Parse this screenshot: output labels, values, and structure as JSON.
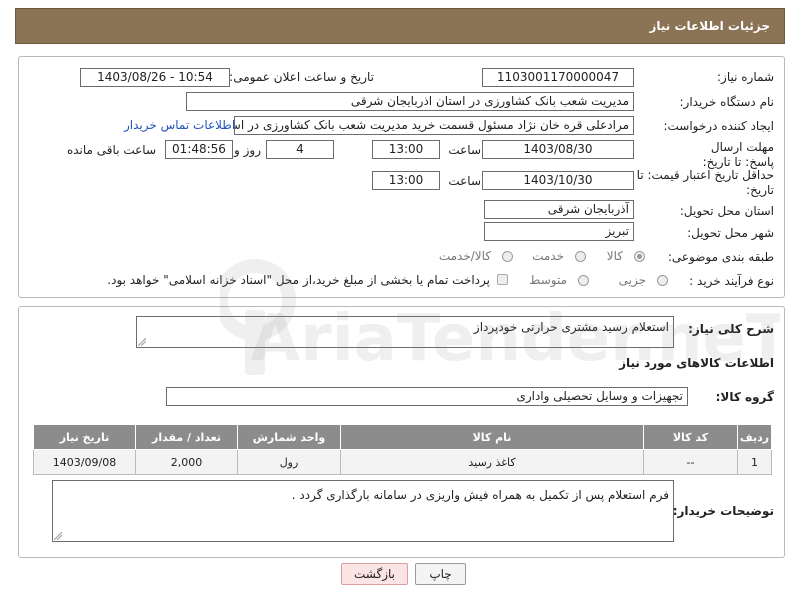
{
  "header": {
    "title": "جزئیات اطلاعات نیاز"
  },
  "labels": {
    "need_number": "شماره نیاز:",
    "announce_datetime": "تاریخ و ساعت اعلان عمومی:",
    "buyer_org": "نام دستگاه خریدار:",
    "requester": "ایجاد کننده درخواست:",
    "reply_deadline": "مهلت ارسال پاسخ: تا تاریخ:",
    "price_validity": "حداقل تاریخ اعتبار قیمت: تا تاریخ:",
    "delivery_province": "استان محل تحویل:",
    "delivery_city": "شهر محل تحویل:",
    "category": "طبقه بندی موضوعی:",
    "purchase_type": "نوع فرآیند خرید :",
    "time": "ساعت",
    "day_and": "روز و",
    "remaining": "ساعت باقی مانده",
    "description": "شرح کلی نیاز:",
    "goods_info": "اطلاعات کالاهای مورد نیاز",
    "goods_group": "گروه کالا:",
    "buyer_notes": "توضیحات خریدار:"
  },
  "values": {
    "need_number": "1103001170000047",
    "announce_datetime": "1403/08/26 - 10:54",
    "buyer_org": "مدیریت شعب بانک کشاورزی در استان اذربایجان شرقی",
    "requester": "مرادعلی قره خان نژاد مسئول قسمت خرید مدیریت شعب بانک کشاورزی در است",
    "contact_link": "اطلاعات تماس خریدار",
    "reply_date": "1403/08/30",
    "reply_time": "13:00",
    "reply_days": "4",
    "reply_remaining": "01:48:56",
    "validity_date": "1403/10/30",
    "validity_time": "13:00",
    "province": "آذربایجان شرقی",
    "city": "تبریز",
    "description": "استعلام رسید مشتری حرارتی خودپرداز",
    "goods_group": "تجهیزات و وسایل تحصیلی واداری",
    "buyer_notes": "فرم استعلام پس از تکمیل به همراه فیش واریزی در سامانه بارگذاری گردد ."
  },
  "category_options": [
    {
      "label": "کالا",
      "selected": true
    },
    {
      "label": "خدمت",
      "selected": false
    },
    {
      "label": "کالا/خدمت",
      "selected": false
    }
  ],
  "purchase_options": [
    {
      "label": "جزیی",
      "selected": false
    },
    {
      "label": "متوسط",
      "selected": false
    }
  ],
  "payment_note": "پرداخت تمام یا بخشی از مبلغ خرید،از محل \"اسناد خزانه اسلامی\" خواهد بود.",
  "table": {
    "headers": [
      "ردیف",
      "کد کالا",
      "نام کالا",
      "واحد شمارش",
      "تعداد / مقدار",
      "تاریخ نیاز"
    ],
    "rows": [
      [
        "1",
        "--",
        "کاغذ رسید",
        "رول",
        "2,000",
        "1403/09/08"
      ]
    ]
  },
  "buttons": {
    "print": "چاپ",
    "back": "بازگشت"
  },
  "watermark": {
    "text": "AriaTender.neT"
  }
}
